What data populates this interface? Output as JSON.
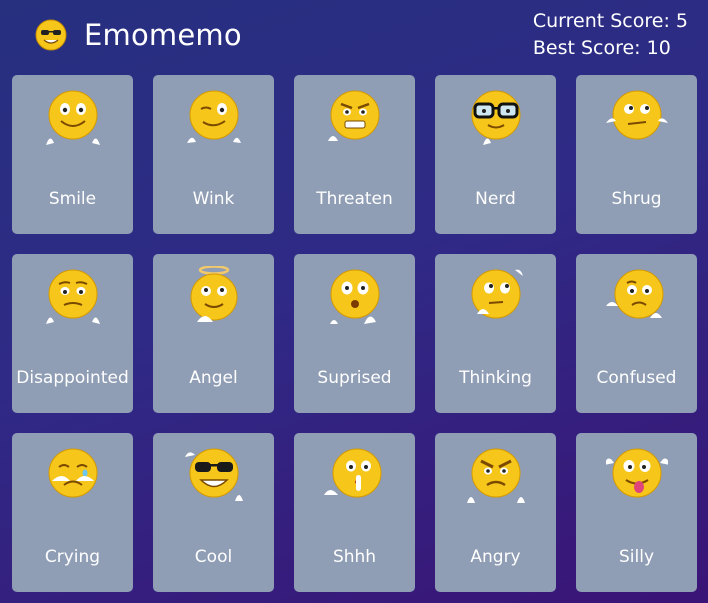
{
  "header": {
    "app_title": "Emomemo",
    "logo_icon": "cool-emoji-icon",
    "current_score": "Current Score: 5",
    "best_score": "Best Score: 10"
  },
  "cards": [
    {
      "label": "Smile",
      "icon": "smile-emoji-icon"
    },
    {
      "label": "Wink",
      "icon": "wink-emoji-icon"
    },
    {
      "label": "Threaten",
      "icon": "threaten-emoji-icon"
    },
    {
      "label": "Nerd",
      "icon": "nerd-emoji-icon"
    },
    {
      "label": "Shrug",
      "icon": "shrug-emoji-icon"
    },
    {
      "label": "Disappointed",
      "icon": "disappointed-emoji-icon"
    },
    {
      "label": "Angel",
      "icon": "angel-emoji-icon"
    },
    {
      "label": "Suprised",
      "icon": "surprised-emoji-icon"
    },
    {
      "label": "Thinking",
      "icon": "thinking-emoji-icon"
    },
    {
      "label": "Confused",
      "icon": "confused-emoji-icon"
    },
    {
      "label": "Crying",
      "icon": "crying-emoji-icon"
    },
    {
      "label": "Cool",
      "icon": "cool-emoji-icon"
    },
    {
      "label": "Shhh",
      "icon": "shhh-emoji-icon"
    },
    {
      "label": "Angry",
      "icon": "angry-emoji-icon"
    },
    {
      "label": "Silly",
      "icon": "silly-emoji-icon"
    }
  ],
  "colors": {
    "card_background": "#8f9db5",
    "emoji_yellow": "#f6c61a"
  }
}
